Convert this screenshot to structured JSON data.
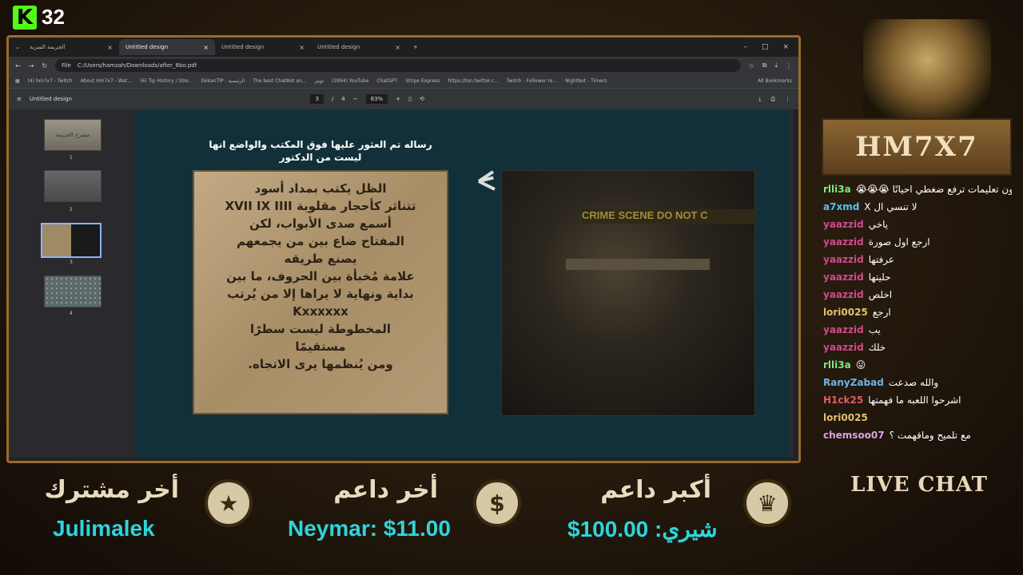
{
  "kick": {
    "count": "32"
  },
  "browser": {
    "tabs": [
      {
        "label": "الجريمة السرية"
      },
      {
        "label": "Untitled design"
      },
      {
        "label": "Untitled design"
      },
      {
        "label": "Untitled design"
      }
    ],
    "new_tab": "+",
    "url_scheme": "File",
    "url": "C:/Users/hamzah/Downloads/after_8bo.pdf",
    "bookmarks": [
      "(4) hm7x7 - Twitch",
      "About Hm7x7 - Wat...",
      "(6) Tip History / Stre...",
      "DokanTIP - الرئيسية",
      "The best ChatBot an...",
      "تويتر",
      "(3994) YouTube",
      "ChatGPT",
      "Stripe Express",
      "https://ton.twitter.c...",
      "Twitch - Follower re...",
      "Nightbot - Timers"
    ],
    "all_bookmarks": "All Bookmarks"
  },
  "pdf": {
    "title": "Untitled design",
    "page": "3",
    "sep": "/",
    "total": "4",
    "zoom": "83%",
    "minus": "−",
    "plus": "+",
    "thumb_numbers": [
      "1",
      "2",
      "3",
      "4"
    ],
    "thumb1_label": "مسرح الجريمة"
  },
  "slide": {
    "caption": "رساله تم العثور عليها فوق المكتب والواضع انها ليست من الدكتور",
    "lines": [
      "الظل يكتب بمداد أسود",
      "تتناثر كأحجار مقلوبة XVII IX IIII",
      "أسمع صدى الأبواب، لكن",
      "المفتاح ضاع بين من يجمعهم",
      "يصنع طريقه",
      "علامة مُخبأة بين الحروف، ما بين",
      "بداية ونهاية لا يراها إلا من يُرتب",
      "Kxxxxxx",
      "المخطوطة ليست سطرًا",
      "مستقيمًا",
      "ومن يُنظمها يرى الاتجاه."
    ],
    "tape_text": "CRIME SCENE DO NOT C"
  },
  "chat": {
    "sign": "HM7X7",
    "live_label": "LIVE CHAT",
    "messages": [
      {
        "user": "rlli3a",
        "color": "#7ee67e",
        "text": "@LIVALOST الالعاب اللي بدون تعليمات ترفع ضغطي احيانًا 😭😭😭"
      },
      {
        "user": "a7xmd",
        "color": "#4fc3f7",
        "text": "ﻻ تنسي ال X"
      },
      {
        "user": "yaazzid",
        "color": "#d14a8b",
        "text": "ياخي"
      },
      {
        "user": "yaazzid",
        "color": "#d14a8b",
        "text": "ارجع اول صورة"
      },
      {
        "user": "yaazzid",
        "color": "#d14a8b",
        "text": "عرفتها"
      },
      {
        "user": "yaazzid",
        "color": "#d14a8b",
        "text": "حليتها"
      },
      {
        "user": "yaazzid",
        "color": "#d14a8b",
        "text": "اخلص"
      },
      {
        "user": "lori0025",
        "color": "#e0c070",
        "text": "ارجع"
      },
      {
        "user": "yaazzid",
        "color": "#d14a8b",
        "text": "يب"
      },
      {
        "user": "yaazzid",
        "color": "#d14a8b",
        "text": "خلك"
      },
      {
        "user": "rlli3a",
        "color": "#7ee67e",
        "text": "😛"
      },
      {
        "user": "RanyZabad",
        "color": "#6fb3e8",
        "text": "والله صدعت"
      },
      {
        "user": "H1ck25",
        "color": "#e05a6a",
        "text": "اشرحوا اللعبه ما فهمتها"
      },
      {
        "user": "lori0025",
        "color": "#e0c070",
        "text": ""
      },
      {
        "user": "chemsoo07",
        "color": "#d9a2e6",
        "text": "مع تلميح وماقهمت ؟"
      }
    ]
  },
  "overlay": {
    "last_sub_label": "أخر مشترك",
    "last_sub": "Julimalek",
    "last_donor_label": "أخر داعم",
    "last_donor": "Neymar: $11.00",
    "top_donor_label": "أكبر داعم",
    "top_donor": "شيري: 100.00$",
    "icons": [
      "star-icon",
      "dollar-icon",
      "crown-icon"
    ]
  }
}
